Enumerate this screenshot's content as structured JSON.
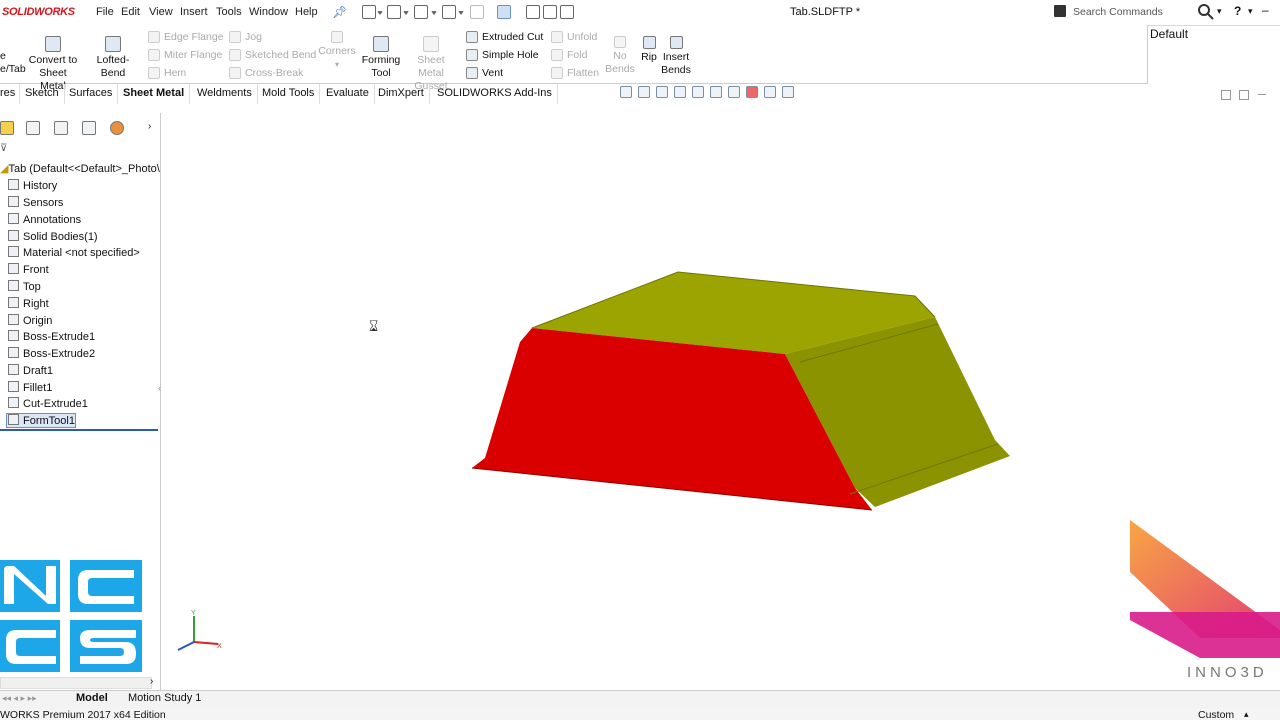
{
  "app": {
    "logo_text": "SOLIDWORKS",
    "document_title": "Tab.SLDFTP *"
  },
  "menu": [
    "File",
    "Edit",
    "View",
    "Insert",
    "Tools",
    "Window",
    "Help"
  ],
  "search": {
    "placeholder": "Search Commands"
  },
  "ribbon": {
    "left_cut": {
      "line1": "e",
      "line2": "e/Tab"
    },
    "convert": {
      "line1": "Convert to",
      "line2": "Sheet Metal"
    },
    "lofted": {
      "label": "Lofted-Bend"
    },
    "edge_flange": "Edge Flange",
    "miter_flange": "Miter Flange",
    "hem": "Hem",
    "jog": "Jog",
    "sketched_bend": "Sketched Bend",
    "cross_break": "Cross-Break",
    "corners": "Corners",
    "forming": {
      "line1": "Forming",
      "line2": "Tool"
    },
    "gusset": {
      "line1": "Sheet Metal",
      "line2": "Gusset"
    },
    "extruded_cut": "Extruded Cut",
    "simple_hole": "Simple Hole",
    "vent": "Vent",
    "unfold": "Unfold",
    "fold": "Fold",
    "flatten": "Flatten",
    "no_bends": {
      "line1": "No",
      "line2": "Bends"
    },
    "rip": "Rip",
    "insert_bends": {
      "line1": "Insert",
      "line2": "Bends"
    }
  },
  "config_default": "Default",
  "tabs": [
    "res",
    "Sketch",
    "Surfaces",
    "Sheet Metal",
    "Weldments",
    "Mold Tools",
    "Evaluate",
    "DimXpert",
    "SOLIDWORKS Add-Ins"
  ],
  "active_tab": "Sheet Metal",
  "tree": {
    "root": "Tab  (Default<<Default>_Photo\\",
    "items": [
      "History",
      "Sensors",
      "Annotations",
      "Solid Bodies(1)",
      "Material <not specified>",
      "Front",
      "Top",
      "Right",
      "Origin",
      "Boss-Extrude1",
      "Boss-Extrude2",
      "Draft1",
      "Fillet1",
      "Cut-Extrude1",
      "FormTool1"
    ],
    "selected": "FormTool1"
  },
  "bottom_tabs": {
    "model": "Model",
    "motion": "Motion Study 1"
  },
  "status": {
    "left": "WORKS Premium 2017 x64 Edition",
    "right": "Custom"
  },
  "watermark": {
    "nccs": "NCCS",
    "inno": "INNO3D"
  },
  "colors": {
    "face_red": "#d80000",
    "face_olive": "#9aa000",
    "face_olive_dark": "#878c00",
    "accent_red": "#d8161b"
  }
}
